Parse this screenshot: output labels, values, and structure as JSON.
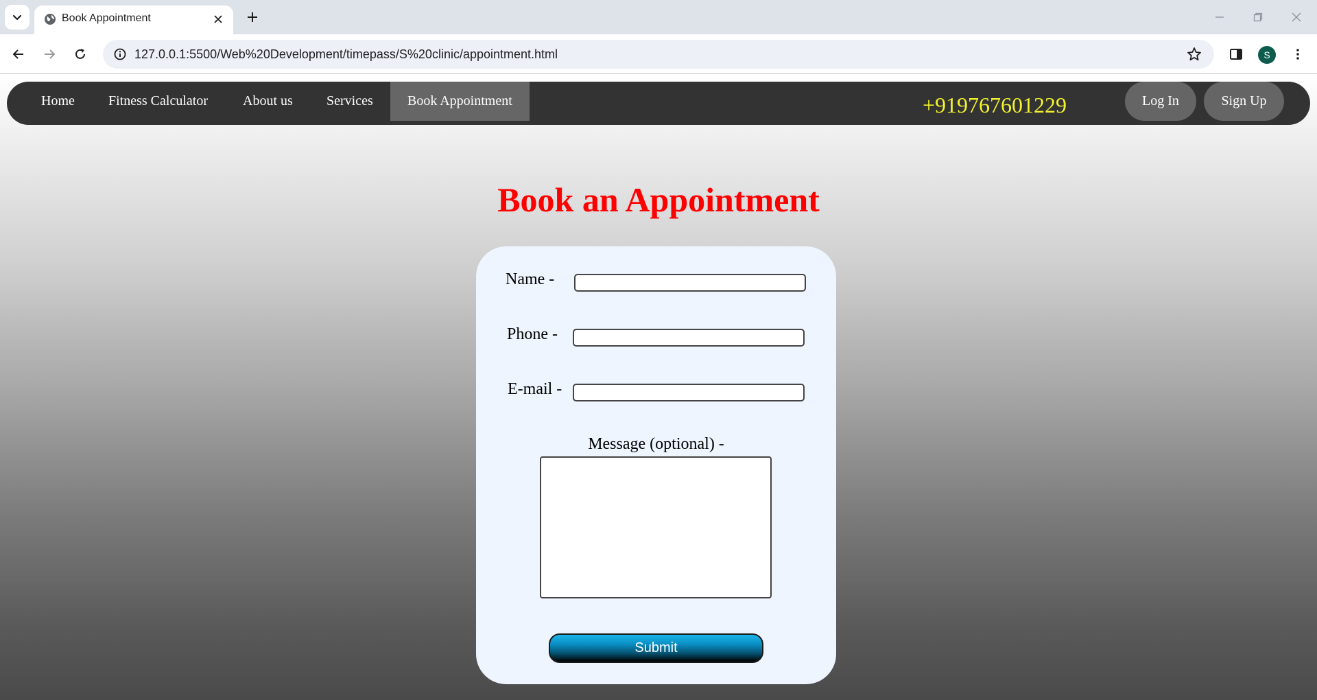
{
  "browser": {
    "tab_title": "Book Appointment",
    "url": "127.0.0.1:5500/Web%20Development/timepass/S%20clinic/appointment.html",
    "profile_initial": "S"
  },
  "nav": {
    "links": [
      {
        "label": "Home",
        "active": false
      },
      {
        "label": "Fitness Calculator",
        "active": false
      },
      {
        "label": "About us",
        "active": false
      },
      {
        "label": "Services",
        "active": false
      },
      {
        "label": "Book Appointment",
        "active": true
      }
    ],
    "phone": "+919767601229",
    "login_label": "Log In",
    "signup_label": "Sign Up"
  },
  "page": {
    "heading": "Book an Appointment"
  },
  "form": {
    "name_label": "Name -",
    "name_value": "",
    "phone_label": "Phone -",
    "phone_value": "",
    "email_label": "E-mail -",
    "email_value": "",
    "message_label": "Message (optional) -",
    "message_value": "",
    "submit_label": "Submit"
  },
  "colors": {
    "heading": "#ff0000",
    "phone": "#f2f22c",
    "nav_bg": "#333333",
    "nav_active": "#666666",
    "card_bg": "#eef5fe"
  }
}
